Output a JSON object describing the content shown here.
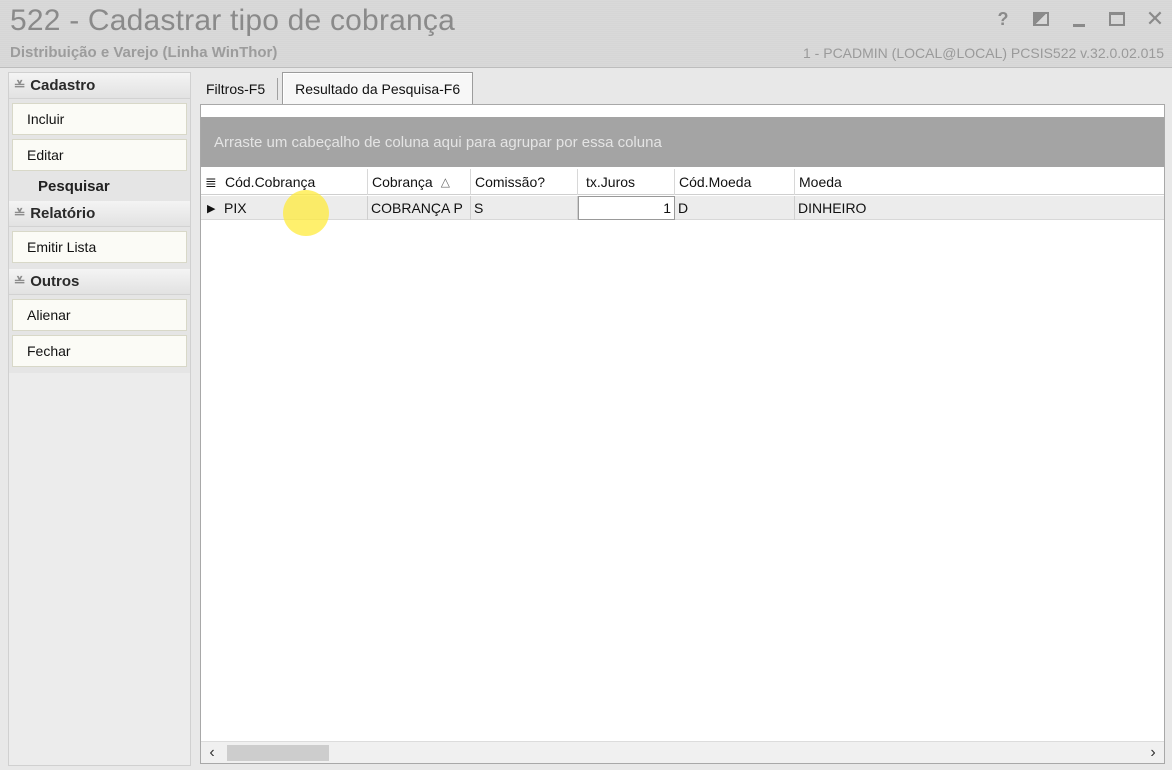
{
  "window": {
    "title": "522 - Cadastrar tipo de cobrança",
    "subtitle": "Distribuição e Varejo (Linha WinThor)",
    "user_info": "1 - PCADMIN (LOCAL@LOCAL)   PCSIS522  v.32.0.02.015",
    "controls": {
      "help": "?",
      "close": "✕"
    }
  },
  "sidebar": {
    "cadastro": {
      "header": "Cadastro",
      "items": [
        "Incluir",
        "Editar"
      ],
      "static": "Pesquisar"
    },
    "relatorio": {
      "header": "Relatório",
      "items": [
        "Emitir Lista"
      ]
    },
    "outros": {
      "header": "Outros",
      "items": [
        "Alienar",
        "Fechar"
      ]
    }
  },
  "tabs": [
    {
      "label": "Filtros-F5",
      "active": false
    },
    {
      "label": "Resultado da Pesquisa-F6",
      "active": true
    }
  ],
  "grid": {
    "group_panel_text": "Arraste um cabeçalho de coluna aqui para agrupar por essa coluna",
    "columns": [
      "Cód.Cobrança",
      "Cobrança",
      "Comissão?",
      "tx.Juros",
      "Cód.Moeda",
      "Moeda"
    ],
    "sort_indicator": "△",
    "rows": [
      {
        "cod_cobranca": "PIX",
        "cobranca": "COBRANÇA P",
        "comissao": "S",
        "tx_juros": "1",
        "cod_moeda": "D",
        "moeda": "DINHEIRO"
      }
    ]
  }
}
